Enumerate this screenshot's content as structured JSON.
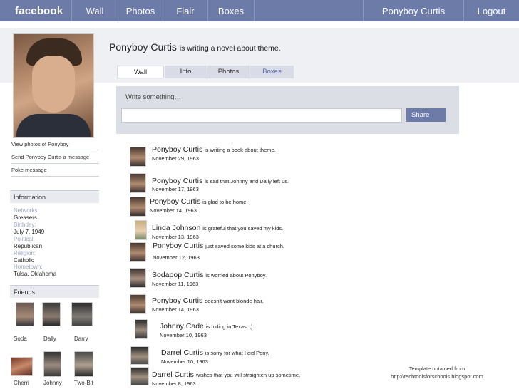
{
  "topbar": {
    "logo": "facebook",
    "nav": [
      "Wall",
      "Photos",
      "Flair",
      "Boxes"
    ],
    "user": "Ponyboy Curtis",
    "logout": "Logout",
    "bg_color": "#6d7ba8"
  },
  "profile": {
    "name": "Ponyboy Curtis",
    "status": "is writing a novel about theme.",
    "tabs": [
      "Wall",
      "Info",
      "Photos",
      "Boxes"
    ],
    "active_tab": "Wall"
  },
  "sidebar": {
    "links": [
      "View photos of Ponyboy",
      "Send Ponyboy Curtis a message",
      "Poke message"
    ],
    "info_header": "Information",
    "info": [
      {
        "label": "Networks:",
        "value": "Greasers"
      },
      {
        "label": "Birthday:",
        "value": "July 7, 1949"
      },
      {
        "label": "Political:",
        "value": "Republican"
      },
      {
        "label": "Religion:",
        "value": "Catholic"
      },
      {
        "label": "Hometown:",
        "value": "Tulsa, Oklahoma"
      }
    ],
    "friends_header": "Friends",
    "friends": [
      "Soda",
      "Dally",
      "Darry",
      "Cherri",
      "Johnny",
      "Two-Bit"
    ]
  },
  "composer": {
    "prompt": "Write something…",
    "share_label": "Share"
  },
  "wall": [
    {
      "name": "Ponyboy Curtis",
      "status": "is writing a book about theme.",
      "date": "November 29, 1963"
    },
    {
      "name": "Ponyboy Curtis",
      "status": "is sad that Johnny and Dally left us.",
      "date": "November 17, 1963"
    },
    {
      "name": "Ponyboy Curtis",
      "status": "is glad to be home.",
      "date": "November 14, 1963"
    },
    {
      "name": "Linda Johnson",
      "status": "is grateful that you saved my kids.",
      "date": "November 13, 1963"
    },
    {
      "name": "Ponyboy Curtis",
      "status": "just saved some kids at a church.",
      "date": "November 12, 1963"
    },
    {
      "name": "Sodapop Curtis",
      "status": "is worried about Ponyboy.",
      "date": "November 11, 1963"
    },
    {
      "name": "Ponyboy Curtis",
      "status": "doesn't want blonde hair.",
      "date": "November 14, 1963"
    },
    {
      "name": "Johnny Cade",
      "status": "is hiding in Texas. ;)",
      "date": "November 10, 1963"
    },
    {
      "name": "Darrel Curtis",
      "status": "is sorry for what I did Pony.",
      "date": "November 10, 1963"
    },
    {
      "name": "Darrel Curtis",
      "status": "wishes that you will straighten up sometime.",
      "date": "November 8, 1963"
    }
  ],
  "credit": {
    "line1": "Template obtained from",
    "line2": "http://techtoolsforschools.blogspot.com"
  }
}
